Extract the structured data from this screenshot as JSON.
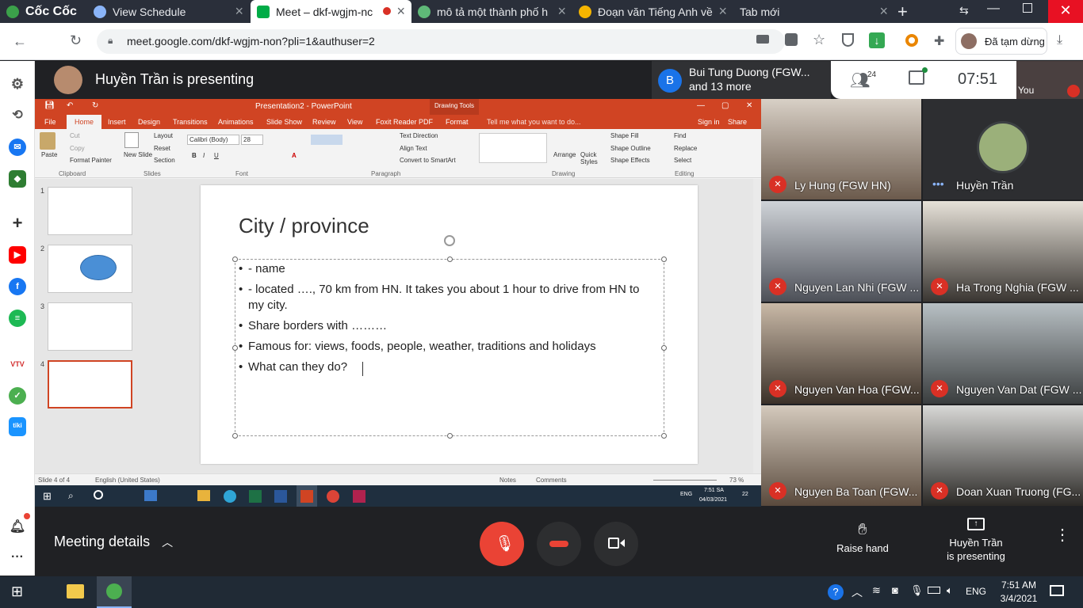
{
  "browser": {
    "tabs": [
      {
        "label": "Cốc Cốc"
      },
      {
        "label": "View Schedule"
      },
      {
        "label": "Meet – dkf-wgjm-nc"
      },
      {
        "label": "mô tả một thành phố h"
      },
      {
        "label": "Đoạn văn Tiếng Anh về"
      },
      {
        "label": "Tab mới"
      }
    ],
    "url": "meet.google.com/dkf-wgjm-non?pli=1&authuser=2",
    "profile_status": "Đã tạm dừng"
  },
  "meet": {
    "presenting_title": "Huyền Trần is presenting",
    "notification_name": "Bui Tung Duong (FGW...",
    "notification_more": "and 13 more",
    "notification_initial": "B",
    "participant_count": "24",
    "clock": "07:51",
    "self_label": "You",
    "participants": [
      {
        "name": "Ly Hung (FGW HN)"
      },
      {
        "name": "Huyền Trần"
      },
      {
        "name": "Nguyen Lan Nhi (FGW ..."
      },
      {
        "name": "Ha Trong Nghia (FGW ..."
      },
      {
        "name": "Nguyen Van Hoa (FGW..."
      },
      {
        "name": "Nguyen Van Dat (FGW ..."
      },
      {
        "name": "Nguyen Ba Toan (FGW..."
      },
      {
        "name": "Doan Xuan Truong (FG..."
      }
    ],
    "meeting_details": "Meeting details",
    "raise_hand": "Raise hand",
    "presenter_status_1": "Huyền Trần",
    "presenter_status_2": "is presenting"
  },
  "powerpoint": {
    "window_title": "Presentation2 - PowerPoint",
    "drawing_tools": "Drawing Tools",
    "menus": [
      "File",
      "Home",
      "Insert",
      "Design",
      "Transitions",
      "Animations",
      "Slide Show",
      "Review",
      "View",
      "Foxit Reader PDF",
      "Format"
    ],
    "tell_me": "Tell me what you want to do...",
    "sign_in": "Sign in",
    "share": "Share",
    "ribbon": {
      "paste": "Paste",
      "cut": "Cut",
      "copy": "Copy",
      "format_painter": "Format Painter",
      "new_slide": "New Slide",
      "layout": "Layout",
      "reset": "Reset",
      "section": "Section",
      "font_name": "Calibri (Body)",
      "font_size": "28",
      "text_direction": "Text Direction",
      "align_text": "Align Text",
      "convert_smartart": "Convert to SmartArt",
      "arrange": "Arrange",
      "quick_styles": "Quick Styles",
      "shape_fill": "Shape Fill",
      "shape_outline": "Shape Outline",
      "shape_effects": "Shape Effects",
      "find": "Find",
      "replace": "Replace",
      "select": "Select",
      "groups": [
        "Clipboard",
        "Slides",
        "Font",
        "Paragraph",
        "Drawing",
        "Editing"
      ]
    },
    "slide_numbers": [
      "1",
      "2",
      "3",
      "4"
    ],
    "slide": {
      "title": "City / province",
      "bullets": [
        "- name",
        "- located …., 70 km from HN. It takes you about 1 hour to drive from HN to my city.",
        "Share borders with ………",
        "Famous for: views, foods, people, weather, traditions and holidays",
        "What can they do?"
      ]
    },
    "status": {
      "slide_of": "Slide 4 of 4",
      "language": "English (United States)",
      "notes": "Notes",
      "comments": "Comments",
      "zoom": "73 %"
    },
    "inner_taskbar": {
      "time": "7:51 SA",
      "date": "04/03/2021",
      "lang": "ENG",
      "badge": "22"
    }
  },
  "taskbar": {
    "time": "7:51 AM",
    "date": "3/4/2021",
    "lang": "ENG"
  },
  "colors": {
    "ppt_accent": "#d04423",
    "meet_bg": "#202124",
    "end_call_red": "#ea4335",
    "mic_off_red": "#d93025"
  }
}
